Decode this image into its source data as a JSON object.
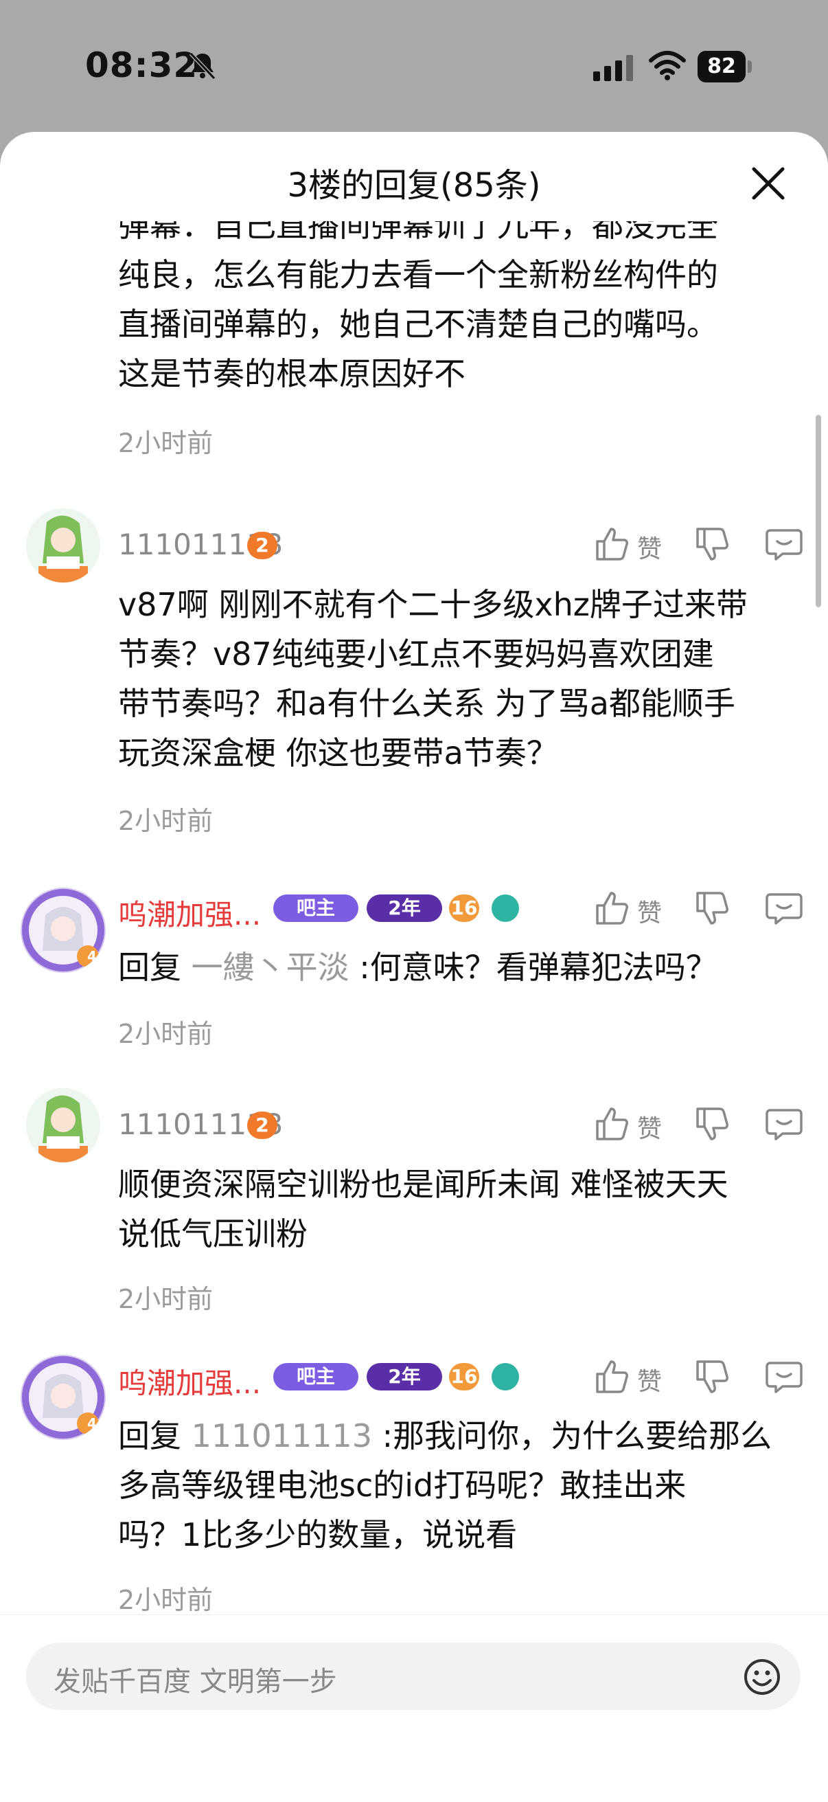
{
  "status": {
    "time": "08:32",
    "battery": "82"
  },
  "sheet": {
    "title": "3楼的回复(85条)"
  },
  "top_comment": {
    "lines": [
      "弹幕：自己直播间弹幕训了九年，都没完全",
      "纯良，怎么有能力去看一个全新粉丝构件的",
      "直播间弹幕的，她自己不清楚自己的嘴吗。",
      "这是节奏的根本原因好不"
    ],
    "time": "2小时前"
  },
  "comments": [
    {
      "user": "111011113",
      "level": "2",
      "lines": [
        "v87啊 刚刚不就有个二十多级xhz牌子过来带",
        "节奏？v87纯纯要小红点不要妈妈喜欢团建",
        "带节奏吗？和a有什么关系 为了骂a都能顺手",
        "玩资深盒梗 你这也要带a节奏？"
      ],
      "time": "2小时前",
      "zan": "赞"
    },
    {
      "user": "呜潮加强...",
      "badges": {
        "owner": "吧主",
        "years": "2年",
        "level": "16",
        "avatar_level": "4"
      },
      "reply_prefix": "回复",
      "reply_to": "一縷丶平淡",
      "reply_text": ":何意味？看弹幕犯法吗？",
      "time": "2小时前",
      "zan": "赞"
    },
    {
      "user": "111011113",
      "level": "2",
      "lines": [
        "顺便资深隔空训粉也是闻所未闻 难怪被天天",
        "说低气压训粉"
      ],
      "time": "2小时前",
      "zan": "赞"
    },
    {
      "user": "呜潮加强...",
      "badges": {
        "owner": "吧主",
        "years": "2年",
        "level": "16",
        "avatar_level": "4"
      },
      "reply_prefix": "回复",
      "reply_to": "111011113",
      "reply_text": ":那我问你，为什么要给那么",
      "lines_more": [
        "多高等级锂电池sc的id打码呢？敢挂出来",
        "吗？1比多少的数量，说说看"
      ],
      "time": "2小时前",
      "zan": "赞"
    }
  ],
  "bottom": {
    "placeholder": "发贴千百度 文明第一步"
  },
  "colors": {
    "red_name": "#e53b3b",
    "owner_badge": "#7c5ce0",
    "years_badge": "#5a2ea6",
    "level_badge": "#f29a3a"
  }
}
